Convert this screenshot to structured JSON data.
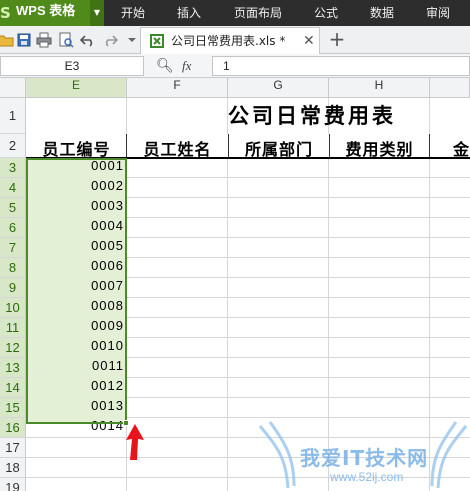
{
  "menubar": {
    "app_logo": "S",
    "app_title": "WPS 表格",
    "tabs": [
      "开始",
      "插入",
      "页面布局",
      "公式",
      "数据",
      "审阅"
    ]
  },
  "toolbar": {
    "icons": [
      "folder-open-icon",
      "save-icon",
      "print-icon",
      "print-preview-icon",
      "undo-icon",
      "redo-icon",
      "dropdown-icon"
    ],
    "doc_tab": {
      "title": "公司日常费用表.xls *",
      "close": "✕"
    },
    "new_tab": "+"
  },
  "formula_bar": {
    "name_box": "E3",
    "fx": "fx",
    "value": "1"
  },
  "sheet": {
    "columns": [
      {
        "label": "E",
        "selected": true
      },
      {
        "label": "F",
        "selected": false
      },
      {
        "label": "G",
        "selected": false
      },
      {
        "label": "H",
        "selected": false
      }
    ],
    "rows": [
      "1",
      "2",
      "3",
      "4",
      "5",
      "6",
      "7",
      "8",
      "9",
      "10",
      "11",
      "12",
      "13",
      "14",
      "15",
      "16",
      "17",
      "18",
      "19"
    ],
    "selected_rows": [
      "3",
      "4",
      "5",
      "6",
      "7",
      "8",
      "9",
      "10",
      "11",
      "12",
      "13",
      "14",
      "15",
      "16"
    ],
    "title": "公司日常费用表",
    "headers": [
      "员工编号",
      "员工姓名",
      "所属部门",
      "费用类别",
      "金"
    ],
    "employee_ids": [
      "0001",
      "0002",
      "0003",
      "0004",
      "0005",
      "0006",
      "0007",
      "0008",
      "0009",
      "0010",
      "0011",
      "0012",
      "0013",
      "0014"
    ]
  },
  "watermark": {
    "text": "我爱IT技术网",
    "url": "www.52ij.com"
  },
  "colors": {
    "menubar_bg": "#2d2d2d",
    "app_green": "#4f8a1b",
    "selection_border": "#4a8a2a",
    "selection_fill": "#e3f0d6",
    "arrow_red": "#e8141b",
    "watermark_blue": "#7fb4e6"
  }
}
